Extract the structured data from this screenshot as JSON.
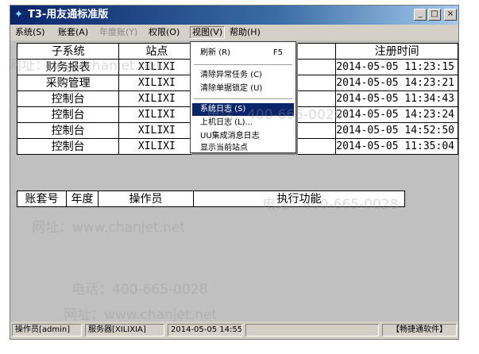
{
  "window": {
    "title": "T3-用友通标准版",
    "buttons": {
      "minimize": "_",
      "maximize": "□",
      "close": "×"
    }
  },
  "menubar": [
    {
      "label": "系统(S)",
      "disabled": false
    },
    {
      "label": "账套(A)",
      "disabled": false
    },
    {
      "label": "年度账(Y)",
      "disabled": true
    },
    {
      "label": "权限(O)",
      "disabled": false
    },
    {
      "label": "视图(V)",
      "disabled": false
    },
    {
      "label": "帮助(H)",
      "disabled": false
    }
  ],
  "view_menu": {
    "items": [
      {
        "label": "刷新 (R)",
        "shortcut": "F5"
      },
      {
        "label": "清除异常任务 (C)",
        "shortcut": ""
      },
      {
        "label": "清除单据锁定 (U)",
        "shortcut": ""
      },
      {
        "label": "系统日志 (S)",
        "shortcut": "",
        "highlighted": true
      },
      {
        "label": "上机日志 (L)...",
        "shortcut": ""
      },
      {
        "label": "UU集成消息日志",
        "shortcut": ""
      },
      {
        "label": "显示当前站点",
        "shortcut": ""
      }
    ]
  },
  "sessions_table": {
    "headers": [
      "子系统",
      "站点",
      "",
      "注册时间"
    ],
    "rows": [
      [
        "财务报表",
        "XILIXI",
        "",
        "2014-05-05 11:23:15"
      ],
      [
        "采购管理",
        "XILIXI",
        "",
        "2014-05-05 14:23:21"
      ],
      [
        "控制台",
        "XILIXI",
        "",
        "2014-05-05 11:34:43"
      ],
      [
        "控制台",
        "XILIXI",
        "",
        "2014-05-05 14:23:24"
      ],
      [
        "控制台",
        "XILIXI",
        "",
        "2014-05-05 14:52:50"
      ],
      [
        "控制台",
        "XILIXI",
        "",
        "2014-05-05 11:35:04"
      ]
    ]
  },
  "tasks_table": {
    "headers": [
      "账套号",
      "年度",
      "操作员",
      "执行功能"
    ]
  },
  "statusbar": {
    "operator": "操作员[admin]",
    "server": "服务器[XILIXIA]",
    "datetime": "2014-05-05 14:55",
    "brand": "【畅捷通软件】"
  },
  "watermark": {
    "phone": "电话：400-665-0028",
    "site": "网址：www.chanjet.net"
  }
}
